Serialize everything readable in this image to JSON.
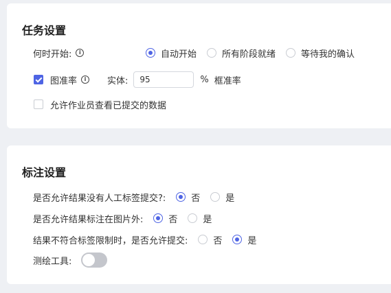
{
  "task_settings": {
    "title": "任务设置",
    "when_start": {
      "label": "何时开始:",
      "options": [
        "自动开始",
        "所有阶段就绪",
        "等待我的确认"
      ],
      "selected": "自动开始"
    },
    "accuracy": {
      "checked": true,
      "label": "图准率",
      "entity_label": "实体:",
      "value": "95",
      "unit": "%",
      "box_label": "框准率"
    },
    "allow_view": {
      "checked": false,
      "label": "允许作业员查看已提交的数据"
    }
  },
  "annotation_settings": {
    "title": "标注设置",
    "q1": {
      "label": "是否允许结果没有人工标签提交?:",
      "options": [
        "否",
        "是"
      ],
      "selected": "否"
    },
    "q2": {
      "label": "是否允许结果标注在图片外:",
      "options": [
        "否",
        "是"
      ],
      "selected": "否"
    },
    "q3": {
      "label": "结果不符合标签限制时，是否允许提交:",
      "options": [
        "否",
        "是"
      ],
      "selected": "是"
    },
    "tool": {
      "label": "测绘工具:",
      "enabled": false
    }
  },
  "colors": {
    "accent": "#4e64e4",
    "background": "#eef0f4"
  }
}
